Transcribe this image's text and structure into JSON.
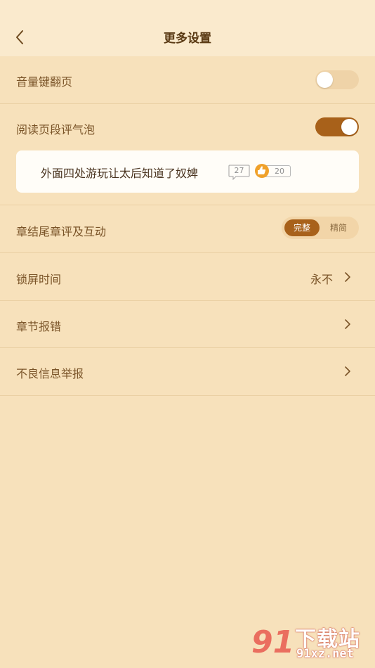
{
  "header": {
    "title": "更多设置"
  },
  "settings": {
    "volume_page_turn": {
      "label": "音量键翻页",
      "enabled": false
    },
    "paragraph_bubble": {
      "label": "阅读页段评气泡",
      "enabled": true
    },
    "preview": {
      "text": "外面四处游玩让太后知道了奴婢",
      "comment_count": "27",
      "like_count": "20"
    },
    "chapter_end": {
      "label": "章结尾章评及互动",
      "options": [
        "完整",
        "精简"
      ],
      "selected": "完整"
    },
    "lock_screen": {
      "label": "锁屏时间",
      "value": "永不"
    },
    "chapter_error": {
      "label": "章节报错"
    },
    "report": {
      "label": "不良信息举报"
    }
  },
  "watermark": {
    "brand_name": "下载站",
    "url": "91xz.net",
    "logo": "91"
  },
  "colors": {
    "background": "#f7e1bb",
    "header": "#faeacd",
    "accent": "#a8611a",
    "text": "#7a5428"
  }
}
